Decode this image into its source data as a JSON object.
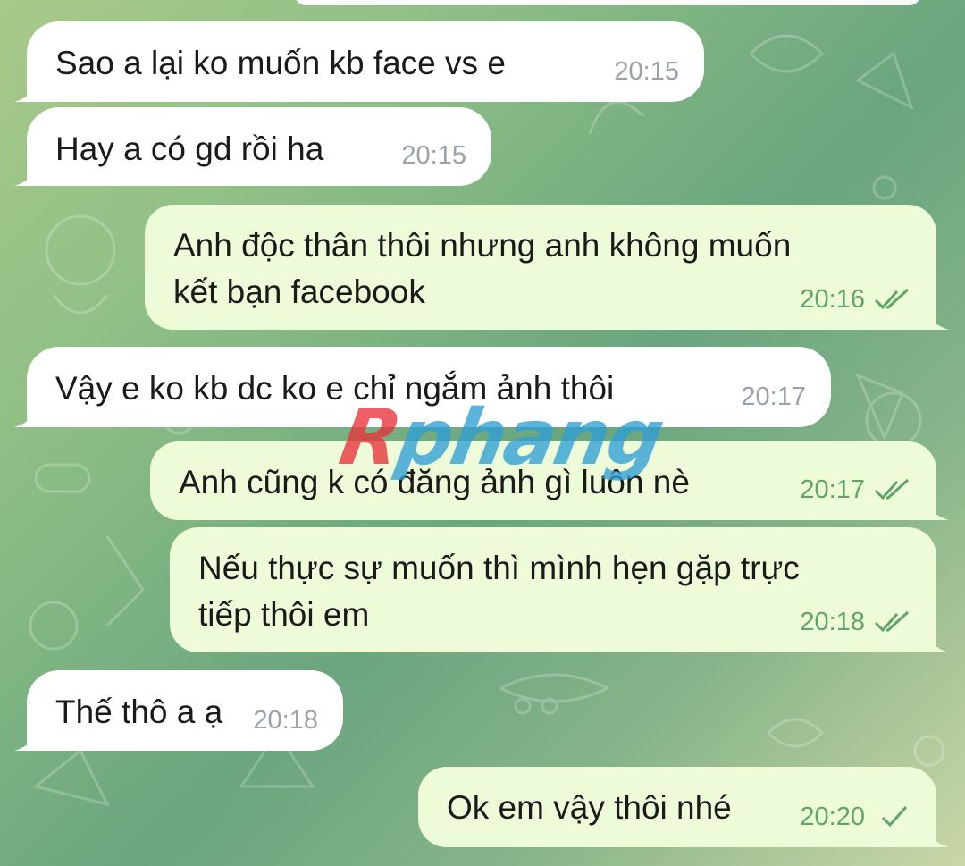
{
  "chat": {
    "messages": [
      {
        "direction": "incoming",
        "text": "Sao a lại ko muốn kb face vs e",
        "time": "20:15"
      },
      {
        "direction": "incoming",
        "text": "Hay a có gd rồi ha",
        "time": "20:15"
      },
      {
        "direction": "outgoing",
        "text": "Anh độc thân thôi nhưng anh không muốn\nkết bạn facebook",
        "time": "20:16",
        "status": "read"
      },
      {
        "direction": "incoming",
        "text": "Vậy e ko kb dc ko e chỉ ngắm ảnh thôi",
        "time": "20:17"
      },
      {
        "direction": "outgoing",
        "text": "Anh cũng k có đăng ảnh gì luôn nè",
        "time": "20:17",
        "status": "read"
      },
      {
        "direction": "outgoing",
        "text": "Nếu thực sự muốn thì mình hẹn gặp trực\ntiếp thôi em",
        "time": "20:18",
        "status": "read"
      },
      {
        "direction": "incoming",
        "text": "Thế thô a ạ",
        "time": "20:18"
      },
      {
        "direction": "outgoing",
        "text": "Ok em vậy thôi nhé",
        "time": "20:20",
        "status": "sent"
      }
    ]
  },
  "watermark": {
    "first_letter": "R",
    "rest": "phang"
  },
  "colors": {
    "incoming_bubble": "#ffffff",
    "outgoing_bubble": "#eefbd9",
    "outgoing_time": "#5fa56a",
    "incoming_time": "#9aa1a8",
    "watermark_red": "#e8333a",
    "watermark_blue": "#2f9fd6"
  },
  "icons": {
    "read": "double-check-icon",
    "sent": "single-check-icon"
  }
}
